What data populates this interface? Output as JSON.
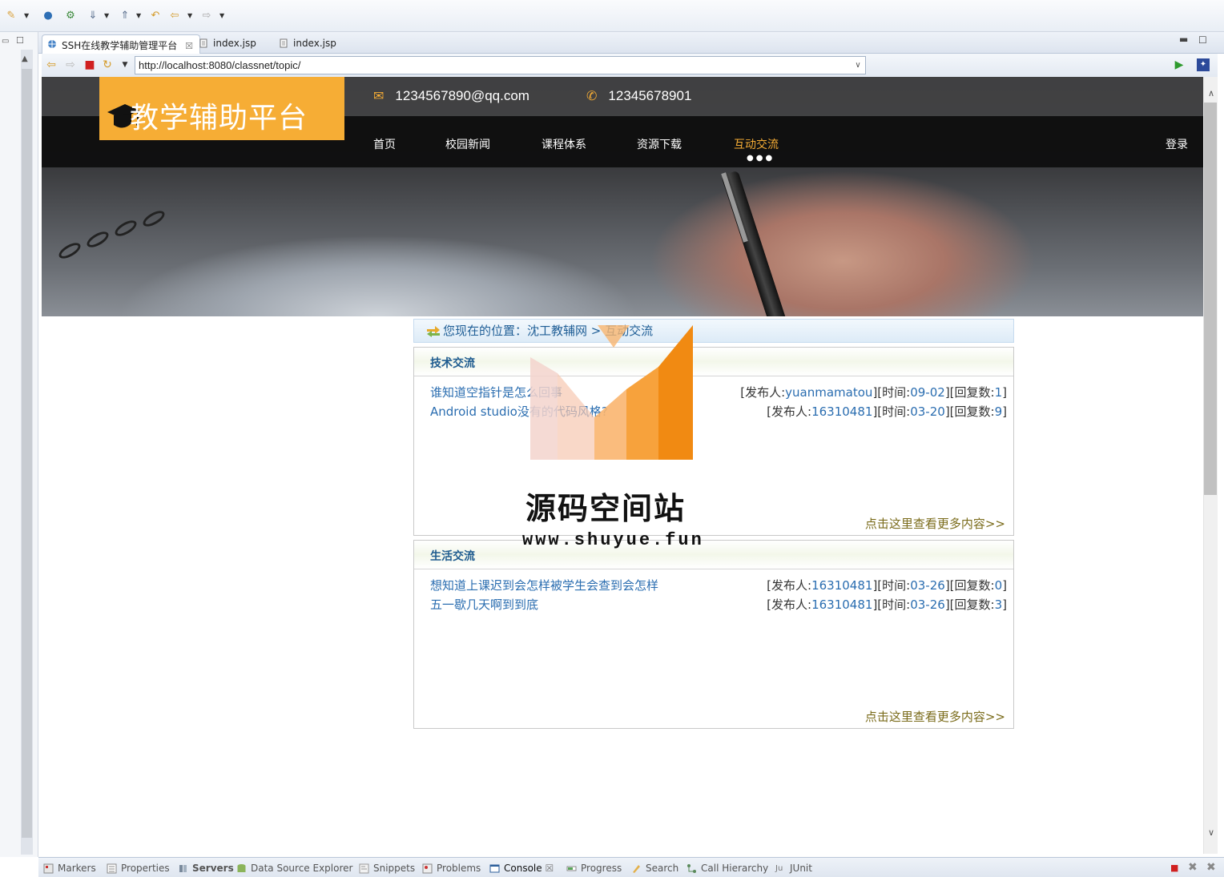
{
  "browser": {
    "tabs": [
      {
        "label": "SSH在线教学辅助管理平台",
        "active": true
      },
      {
        "label": "index.jsp",
        "active": false
      },
      {
        "label": "index.jsp",
        "active": false
      }
    ],
    "url": "http://localhost:8080/classnet/topic/"
  },
  "site": {
    "logo_text": "教学辅助平台",
    "email": "1234567890@qq.com",
    "phone": "12345678901",
    "menu": [
      "首页",
      "校园新闻",
      "课程体系",
      "资源下载",
      "互动交流"
    ],
    "active_menu": "互动交流",
    "login": "登录",
    "accent": "#f6ad35"
  },
  "breadcrumb": {
    "prefix": "您现在的位置：",
    "path": "沈工教辅网 > 互动交流"
  },
  "sections": [
    {
      "title": "技术交流",
      "items": [
        {
          "title": "谁知道空指针是怎么回事",
          "author": "yuanmamatou",
          "time": "09-02",
          "replies": "1"
        },
        {
          "title": "Android studio没有的代码风格?",
          "author": "16310481",
          "time": "03-20",
          "replies": "9"
        }
      ],
      "more": "点击这里查看更多内容>>"
    },
    {
      "title": "生活交流",
      "items": [
        {
          "title": "想知道上课迟到会怎样被学生会查到会怎样",
          "author": "16310481",
          "time": "03-26",
          "replies": "0"
        },
        {
          "title": "五一歇几天啊到到底",
          "author": "16310481",
          "time": "03-26",
          "replies": "3"
        }
      ],
      "more": "点击这里查看更多内容>>"
    }
  ],
  "labels": {
    "author": "发布人:",
    "time": "时间:",
    "replies": "回复数:"
  },
  "watermark": {
    "title": "源码空间站",
    "url": "www.shuyue.fun"
  },
  "bottom_tabs": [
    "Markers",
    "Properties",
    "Servers",
    "Data Source Explorer",
    "Snippets",
    "Problems",
    "Console",
    "Progress",
    "Search",
    "Call Hierarchy",
    "JUnit"
  ],
  "active_bottom_tab": "Console"
}
